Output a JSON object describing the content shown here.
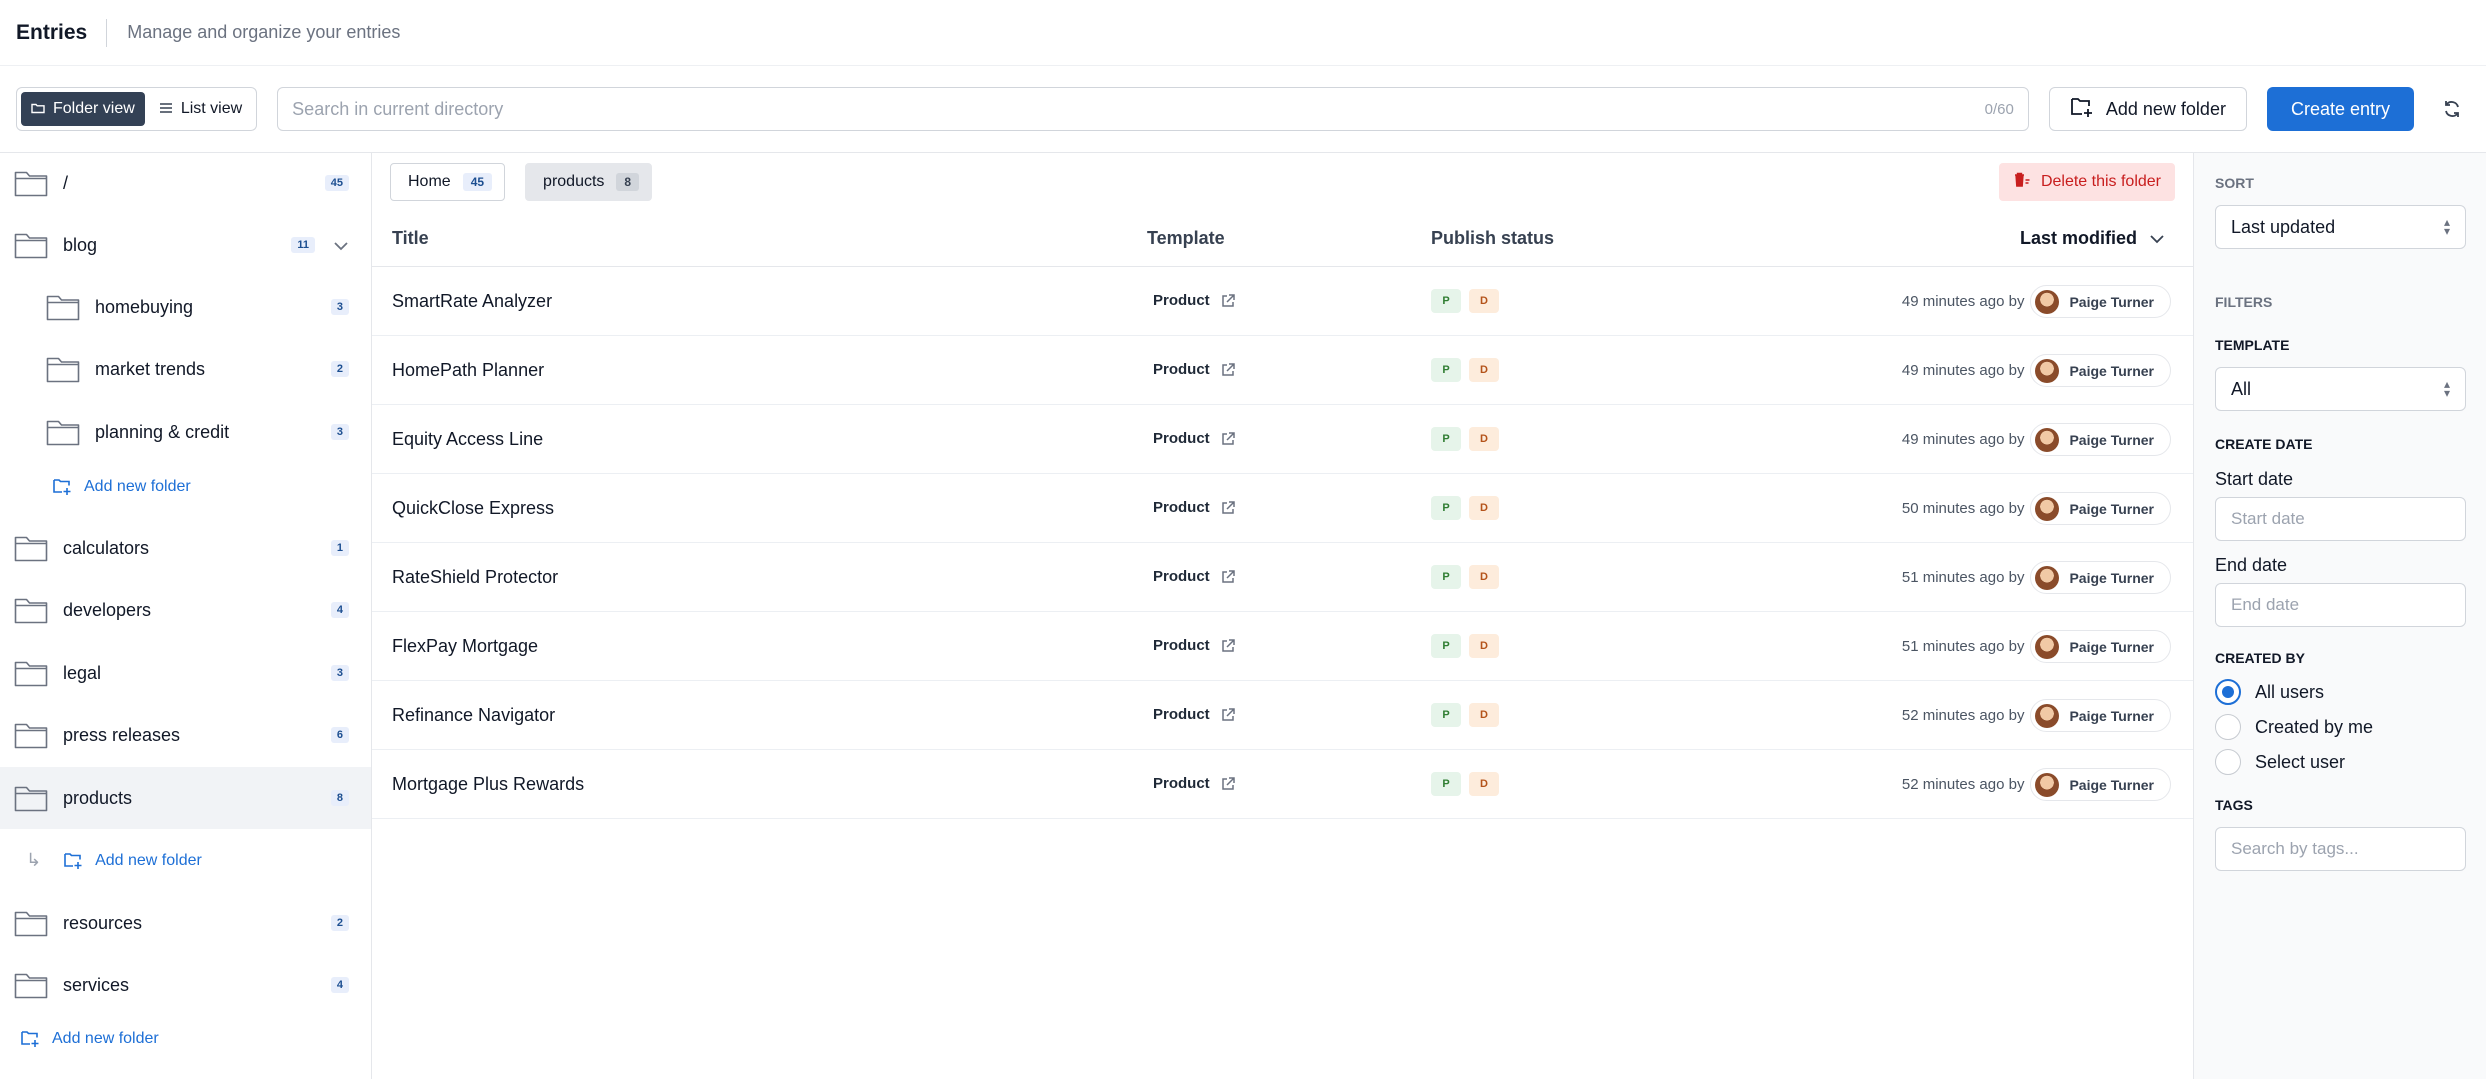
{
  "header": {
    "title": "Entries",
    "subtitle": "Manage and organize your entries"
  },
  "toolbar": {
    "folder_view_label": "Folder view",
    "list_view_label": "List view",
    "search_placeholder": "Search in current directory",
    "search_counter": "0/60",
    "add_folder_label": "Add new folder",
    "create_entry_label": "Create entry"
  },
  "sidebar": {
    "folders": [
      {
        "name": "/",
        "count": "45"
      },
      {
        "name": "blog",
        "count": "11"
      },
      {
        "name": "homebuying",
        "count": "3"
      },
      {
        "name": "market trends",
        "count": "2"
      },
      {
        "name": "planning & credit",
        "count": "3"
      },
      {
        "name": "calculators",
        "count": "1"
      },
      {
        "name": "developers",
        "count": "4"
      },
      {
        "name": "legal",
        "count": "3"
      },
      {
        "name": "press releases",
        "count": "6"
      },
      {
        "name": "products",
        "count": "8"
      },
      {
        "name": "resources",
        "count": "2"
      },
      {
        "name": "services",
        "count": "4"
      }
    ],
    "add_folder_label": "Add new folder"
  },
  "breadcrumbs": [
    {
      "label": "Home",
      "count": "45"
    },
    {
      "label": "products",
      "count": "8"
    }
  ],
  "delete_folder_label": "Delete this folder",
  "table": {
    "columns": {
      "title": "Title",
      "template": "Template",
      "status": "Publish status",
      "modified": "Last modified"
    },
    "rows": [
      {
        "title": "SmartRate Analyzer",
        "template": "Product",
        "p": "P",
        "d": "D",
        "time": "49 minutes ago by",
        "user": "Paige Turner"
      },
      {
        "title": "HomePath Planner",
        "template": "Product",
        "p": "P",
        "d": "D",
        "time": "49 minutes ago by",
        "user": "Paige Turner"
      },
      {
        "title": "Equity Access Line",
        "template": "Product",
        "p": "P",
        "d": "D",
        "time": "49 minutes ago by",
        "user": "Paige Turner"
      },
      {
        "title": "QuickClose Express",
        "template": "Product",
        "p": "P",
        "d": "D",
        "time": "50 minutes ago by",
        "user": "Paige Turner"
      },
      {
        "title": "RateShield Protector",
        "template": "Product",
        "p": "P",
        "d": "D",
        "time": "51 minutes ago by",
        "user": "Paige Turner"
      },
      {
        "title": "FlexPay Mortgage",
        "template": "Product",
        "p": "P",
        "d": "D",
        "time": "51 minutes ago by",
        "user": "Paige Turner"
      },
      {
        "title": "Refinance Navigator",
        "template": "Product",
        "p": "P",
        "d": "D",
        "time": "52 minutes ago by",
        "user": "Paige Turner"
      },
      {
        "title": "Mortgage Plus Rewards",
        "template": "Product",
        "p": "P",
        "d": "D",
        "time": "52 minutes ago by",
        "user": "Paige Turner"
      }
    ]
  },
  "filters": {
    "sort_label": "SORT",
    "sort_value": "Last updated",
    "filters_label": "FILTERS",
    "template_label": "TEMPLATE",
    "template_value": "All",
    "create_date_label": "CREATE DATE",
    "start_date_label": "Start date",
    "start_date_placeholder": "Start date",
    "end_date_label": "End date",
    "end_date_placeholder": "End date",
    "created_by_label": "CREATED BY",
    "created_by_options": [
      "All users",
      "Created by me",
      "Select user"
    ],
    "tags_label": "TAGS",
    "tags_placeholder": "Search by tags..."
  },
  "colors": {
    "primary": "#1d6fd6",
    "active_toggle": "#334155",
    "delete_bg": "#fde2e2",
    "delete_text": "#c81e1e"
  },
  "icons": [
    "folder-icon",
    "chevron-down-icon",
    "add-folder-icon",
    "refresh-icon",
    "external-link-icon",
    "trash-icon",
    "list-icon",
    "avatar"
  ]
}
